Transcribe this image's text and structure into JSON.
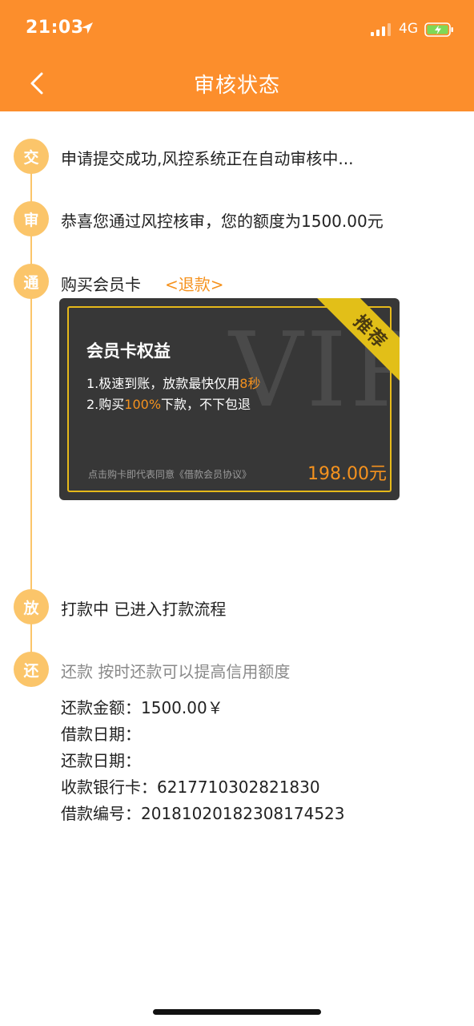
{
  "status_bar": {
    "time": "21:03",
    "network": "4G"
  },
  "nav": {
    "title": "审核状态"
  },
  "steps": [
    {
      "node": "交",
      "text": "申请提交成功,风控系统正在自动审核中..."
    },
    {
      "node": "审",
      "text": "恭喜您通过风控核审，您的额度为1500.00元"
    },
    {
      "node": "通",
      "text": "购买会员卡",
      "link": "<退款>"
    },
    {
      "node": "放",
      "text": "打款中 已进入打款流程"
    },
    {
      "node": "还",
      "text": "还款 按时还款可以提高信用额度"
    }
  ],
  "card": {
    "watermark": "VIP",
    "ribbon": "推荐",
    "title": "会员卡权益",
    "line1_prefix": "1.极速到账，放款最快仅用",
    "line1_highlight": "8秒",
    "line2_prefix": "2.购买",
    "line2_highlight": "100%",
    "line2_suffix": "下款，不下包退",
    "agreement": "点击购卡即代表同意《借款会员协议》",
    "price": "198.00元"
  },
  "details": {
    "repay_amount": "还款金额：1500.00￥",
    "loan_date": "借款日期：",
    "repay_date": "还款日期：",
    "bank_card": "收款银行卡：6217710302821830",
    "loan_number": "借款编号：20181020182308174523"
  },
  "colors": {
    "header": "#fc8e2c",
    "accent": "#f5921e",
    "node": "#fbc56a",
    "card_bg": "#373737",
    "gold": "#e2bf18"
  }
}
